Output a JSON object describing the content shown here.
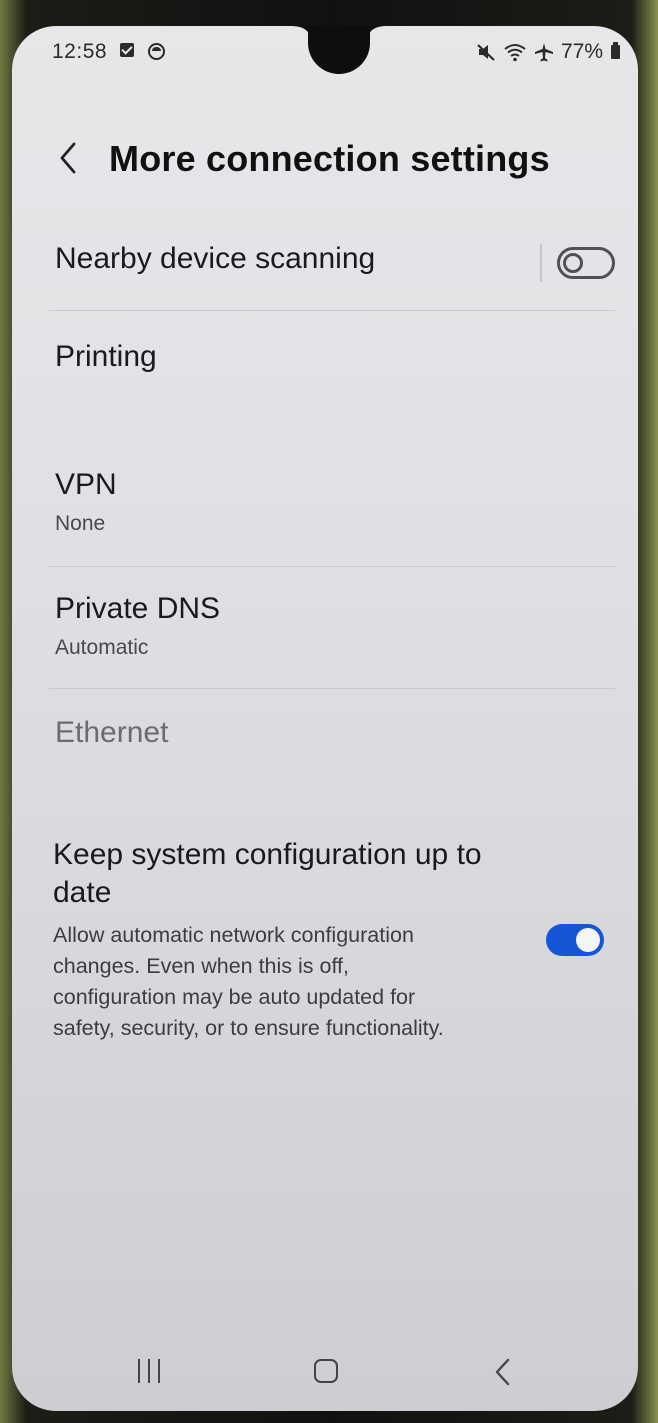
{
  "status_bar": {
    "time": "12:58",
    "battery": "77%"
  },
  "header": {
    "title": "More connection settings"
  },
  "settings": {
    "nearby": {
      "label": "Nearby device scanning",
      "enabled": false
    },
    "printing": {
      "label": "Printing"
    },
    "vpn": {
      "label": "VPN",
      "value": "None"
    },
    "private_dns": {
      "label": "Private DNS",
      "value": "Automatic"
    },
    "ethernet": {
      "label": "Ethernet"
    },
    "keep_config": {
      "label_line1": "Keep system configuration up to",
      "label_line2": "date",
      "desc_line1": "Allow automatic network configuration",
      "desc_line2": "changes. Even when this is off,",
      "desc_line3": "configuration may be auto updated for",
      "desc_line4": "safety, security, or to ensure functionality.",
      "enabled": true
    }
  },
  "colors": {
    "accent": "#1656d6",
    "background": "#e3e4e6"
  },
  "icons": {
    "status_left": [
      "notification-check-icon",
      "app-circle-icon"
    ],
    "status_right": [
      "mute-icon",
      "wifi-icon",
      "airplane-icon",
      "battery-icon"
    ],
    "header": "back-chevron-icon",
    "nav": [
      "recents-icon",
      "home-icon",
      "back-icon"
    ]
  }
}
